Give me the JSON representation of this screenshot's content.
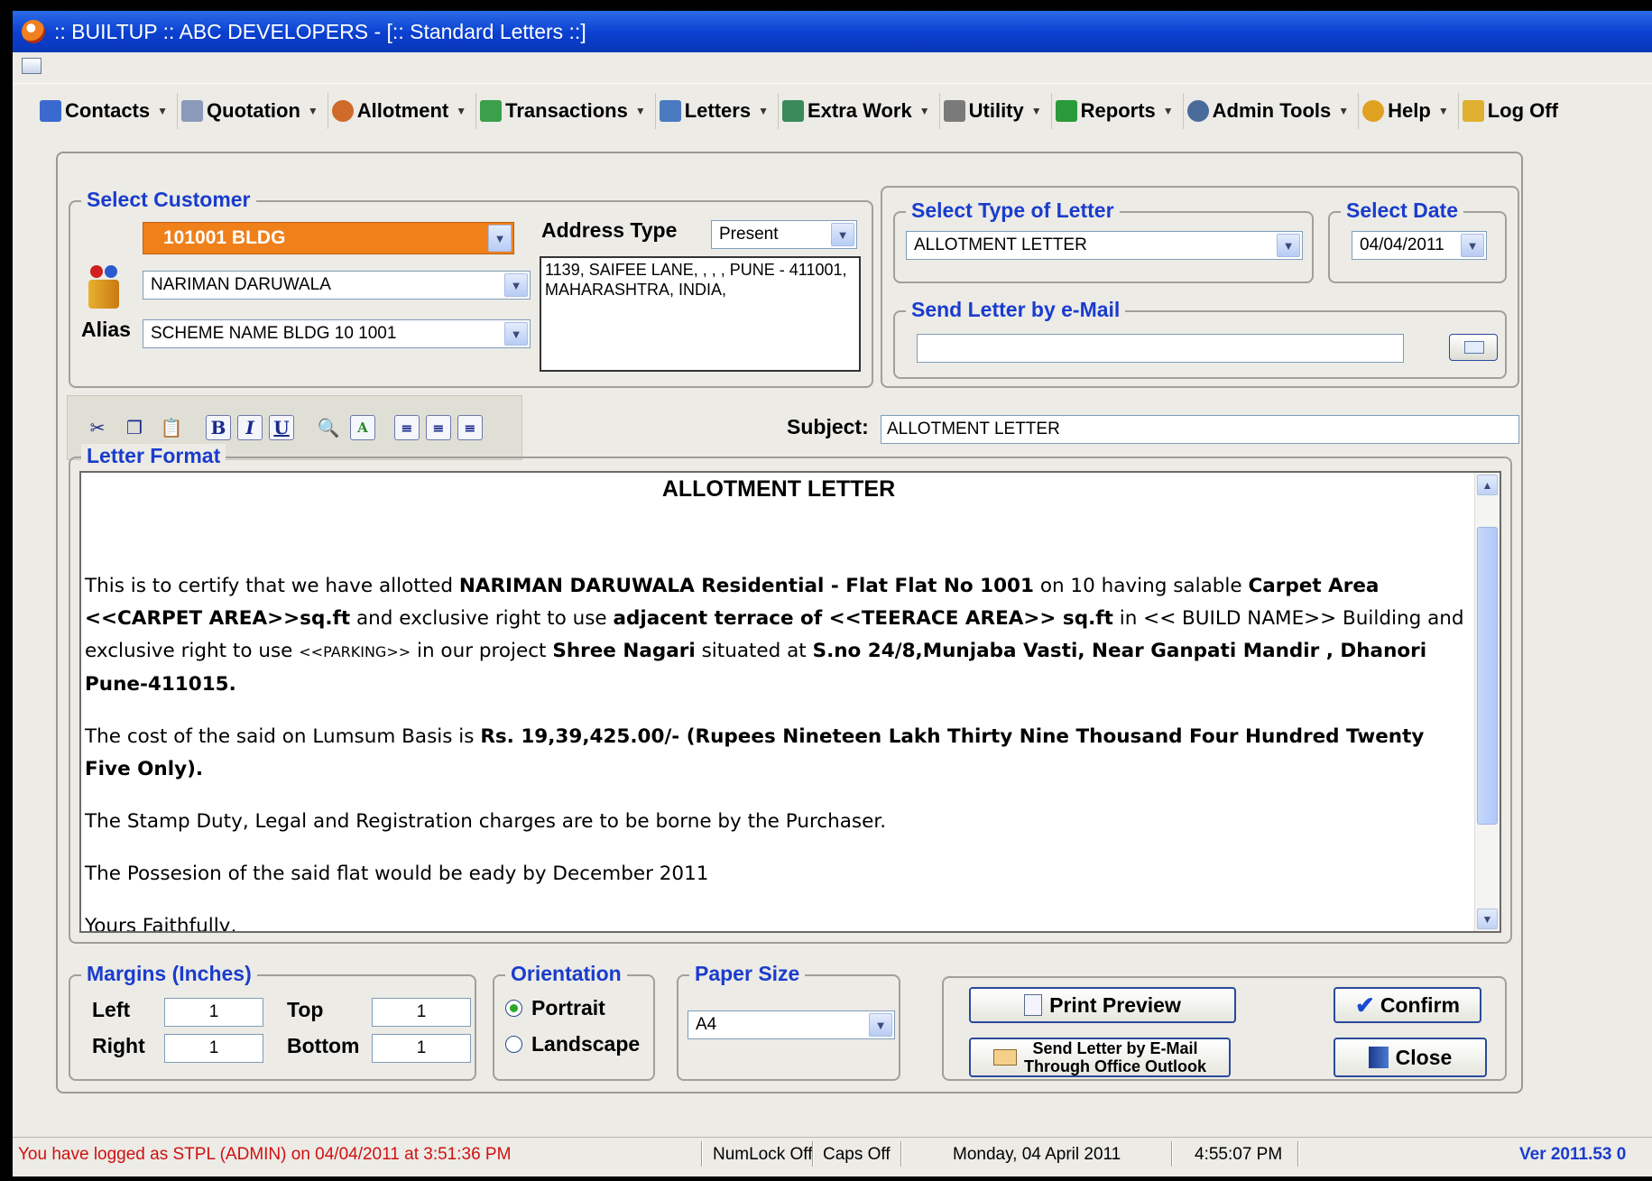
{
  "window": {
    "title": ":: BUILTUP :: ABC DEVELOPERS - [:: Standard Letters ::]"
  },
  "menu": [
    {
      "label": "Contacts",
      "icon": "contacts-icon",
      "color": "#3a6ad0"
    },
    {
      "label": "Quotation",
      "icon": "quotation-icon",
      "color": "#5a6a9a"
    },
    {
      "label": "Allotment",
      "icon": "allotment-icon",
      "color": "#d06a2a"
    },
    {
      "label": "Transactions",
      "icon": "transactions-icon",
      "color": "#3aa04a"
    },
    {
      "label": "Letters",
      "icon": "letters-icon",
      "color": "#4a7ac0"
    },
    {
      "label": "Extra Work",
      "icon": "extra-work-icon",
      "color": "#3a8a5a"
    },
    {
      "label": "Utility",
      "icon": "utility-icon",
      "color": "#6a6a6a"
    },
    {
      "label": "Reports",
      "icon": "reports-icon",
      "color": "#2a9a3a"
    },
    {
      "label": "Admin Tools",
      "icon": "admin-tools-icon",
      "color": "#4a6a9a"
    },
    {
      "label": "Help",
      "icon": "help-icon",
      "color": "#e0a020"
    },
    {
      "label": "Log Off",
      "icon": "log-off-icon",
      "color": "#e0b030"
    }
  ],
  "customer": {
    "group_title": "Select Customer",
    "unit": "101001 BLDG",
    "name": "NARIMAN  DARUWALA",
    "alias_label": "Alias",
    "alias": "SCHEME NAME BLDG 10 1001",
    "address_type_label": "Address Type",
    "address_type": "Present",
    "address": "1139, SAIFEE LANE, , , , PUNE - 411001,\nMAHARASHTRA, INDIA,"
  },
  "letter_type": {
    "group_title": "Select Type of Letter",
    "value": "ALLOTMENT LETTER"
  },
  "date": {
    "group_title": "Select Date",
    "value": "04/04/2011"
  },
  "email": {
    "group_title": "Send Letter by e-Mail",
    "value": ""
  },
  "subject": {
    "label": "Subject:",
    "value": "ALLOTMENT LETTER"
  },
  "toolbar": {
    "bold": "B",
    "italic": "I",
    "underline": "U"
  },
  "letter": {
    "group_title": "Letter Format",
    "title": "ALLOTMENT LETTER",
    "p1_a": "This is to certify that we have allotted ",
    "p1_b": "NARIMAN  DARUWALA  Residential - Flat Flat No 1001",
    "p1_c": " on 10 having salable ",
    "p1_d": "Carpet Area <<CARPET AREA>>sq.ft",
    "p1_e": " and exclusive right to use ",
    "p1_f": "adjacent terrace of  <<TEERACE AREA>> sq.ft",
    "p1_g": " in << BUILD NAME>> Building and exclusive right to use ",
    "p1_h": "<<PARKING>>",
    "p1_i": "  in our project ",
    "p1_j": "Shree Nagari",
    "p1_k": "  situated at ",
    "p1_l": "S.no 24/8,Munjaba Vasti, Near Ganpati Mandir , Dhanori Pune-411015.",
    "p2_a": "The cost of the said on Lumsum Basis  is ",
    "p2_b": "Rs. 19,39,425.00/- (Rupees  Nineteen Lakh Thirty  Nine  Thousand  Four  Hundred  Twenty  Five Only).",
    "p3": "The Stamp Duty, Legal and Registration charges are to be borne by the Purchaser.",
    "p4": "The Possesion of the said flat would be eady by December 2011",
    "p5": "Yours Faithfully,"
  },
  "margins": {
    "group_title": "Margins (Inches)",
    "left_label": "Left",
    "left": "1",
    "top_label": "Top",
    "top": "1",
    "right_label": "Right",
    "right": "1",
    "bottom_label": "Bottom",
    "bottom": "1"
  },
  "orientation": {
    "group_title": "Orientation",
    "portrait": "Portrait",
    "landscape": "Landscape",
    "selected": "Portrait"
  },
  "paper": {
    "group_title": "Paper Size",
    "value": "A4"
  },
  "buttons": {
    "print_preview": "Print Preview",
    "send_outlook_1": "Send  Letter by E-Mail",
    "send_outlook_2": "Through  Office  Outlook",
    "confirm": "Confirm",
    "close": "Close"
  },
  "status": {
    "login": "You have logged as STPL (ADMIN) on 04/04/2011 at 3:51:36 PM",
    "numlock": "NumLock Off",
    "caps": "Caps Off",
    "date": "Monday, 04  April  2011",
    "time": "4:55:07 PM",
    "version": "Ver 2011.53 0",
    "login_color": "#d01010",
    "version_color": "#1a3ccc"
  }
}
